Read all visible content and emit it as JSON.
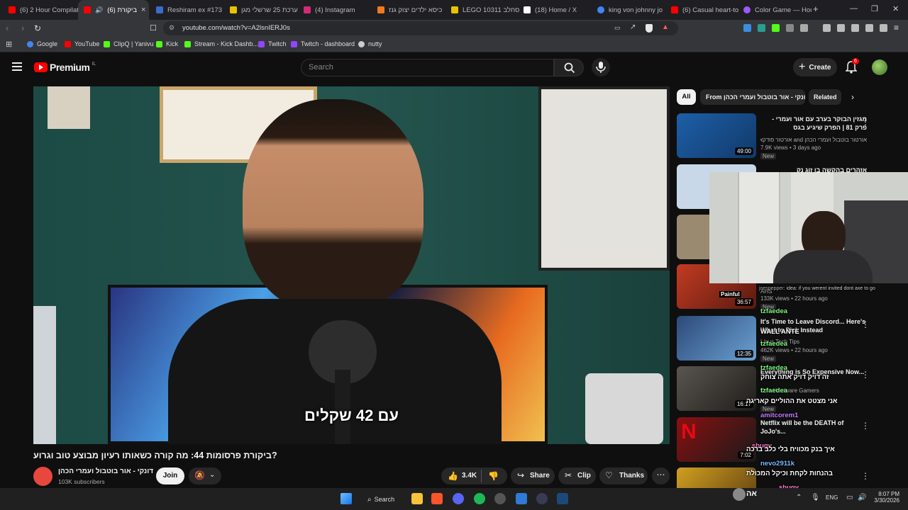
{
  "tabs": [
    {
      "title": "(6) 2 Hour Compilat",
      "fav_color": "#ff0000"
    },
    {
      "title": "(6) ביקורת",
      "fav_color": "#ff0000",
      "active": true
    },
    {
      "title": "Reshiram ex #173 P",
      "fav_color": "#3b6cc8"
    },
    {
      "title": "ערכת 25 שרשלי מגן",
      "fav_color": "#e8c400"
    },
    {
      "title": "(4) Instagram",
      "fav_color": "#d62976"
    },
    {
      "title": "כיסא ילדים יצוק גנז",
      "fav_color": "#f07b1d"
    },
    {
      "title": "LEGO 10311 סחלב",
      "fav_color": "#e8c400"
    },
    {
      "title": "(18) Home / X",
      "fav_color": "#ffffff"
    },
    {
      "title": "king von johnny jo",
      "fav_color": "#4285f4"
    },
    {
      "title": "(6) Casual heart-to-",
      "fav_color": "#ff0000"
    },
    {
      "title": "Color Game — Hou",
      "fav_color": "#9b59ff"
    }
  ],
  "browser": {
    "url": "youtube.com/watch?v=A2lsnIERJ0s",
    "new_tab": "+",
    "close_tab": "×"
  },
  "bookmarks": [
    {
      "label": "Google",
      "color": "#4285f4"
    },
    {
      "label": "YouTube",
      "color": "#ff0000"
    },
    {
      "label": "ClipQ | Yanivu",
      "color": "#53fc18"
    },
    {
      "label": "Kick",
      "color": "#53fc18"
    },
    {
      "label": "Stream - Kick Dashb...",
      "color": "#53fc18"
    },
    {
      "label": "Twitch",
      "color": "#9146ff"
    },
    {
      "label": "Twitch - dashboard",
      "color": "#9146ff"
    },
    {
      "label": "nutty",
      "color": "#cccccc"
    }
  ],
  "youtube": {
    "logo": "Premium",
    "logo_sup": "IL",
    "search_placeholder": "Search",
    "create_label": "Create",
    "notif_count": "6",
    "chips": [
      "All",
      "From דונקי - אור בוטבול ועמרי הכהן",
      "Related"
    ],
    "video_subtitle": "עם 42 שקלים",
    "video_title": "ביקורת פרסומות 44: מה קורה כשאותו רעיון מבוצע טוב וגרוע?",
    "channel_name": "דונקי - אור בוטבול ועמרי הכהן",
    "subscribers": "103K subscribers",
    "join_label": "Join",
    "likes": "3.4K",
    "share_label": "Share",
    "clip_label": "Clip",
    "thanks_label": "Thanks"
  },
  "sidebar": [
    {
      "title": "מגזין הבוקר בערב עם אור ועמרי - פרק 81 | הפרק שיגיע בגס",
      "channel": "אורטור בוטבול ועמרי הכהן and אורטור פודקאסטים",
      "meta": "7.9K views • 3 days ago",
      "badge": "New",
      "dur": "49:00",
      "thumb": "#1d5fa8"
    },
    {
      "title": "אזהרים בהקשה בן זוג נק",
      "channel": "",
      "meta": "",
      "badge": "",
      "dur": "",
      "thumb": "#c8d8e8"
    },
    {
      "title": "",
      "channel": "",
      "meta": "",
      "badge": "",
      "dur": "",
      "thumb": "#9a8a70"
    },
    {
      "title": "Painful",
      "channel": "AHS",
      "meta": "133K views • 22 hours ago",
      "badge": "New",
      "dur": "36:57",
      "thumb": "#c23b22"
    },
    {
      "title": "It's Time to Leave Discord... Here's What to Pick Instead",
      "channel": "Linus Tech Tips",
      "meta": "462K views • 22 hours ago",
      "badge": "New",
      "dur": "12:35",
      "thumb": "#2c4a7a"
    },
    {
      "title": "Everything is So Expensive Now...",
      "channel": "Tom Hardware Gamers",
      "meta": "",
      "badge": "New",
      "dur": "16:17",
      "thumb": "#5a5550"
    },
    {
      "title": "Netflix will be the DEATH of JoJo's...",
      "channel": "",
      "meta": "",
      "badge": "",
      "dur": "7:02",
      "thumb": "#8a1010"
    },
    {
      "title": "",
      "channel": "",
      "meta": "",
      "badge": "",
      "dur": "",
      "thumb": "#d0a020"
    }
  ],
  "chat": [
    {
      "user": "joespepper",
      "text": "idea: if you werent invited dont axe to go"
    },
    {
      "user": "tzfaedea",
      "text": ""
    },
    {
      "user": "",
      "text": "WALL ANTE"
    },
    {
      "user": "tzfaedea",
      "text": ""
    },
    {
      "user": "tzfaedea",
      "text": "זה דויק דויק אתה צוחק"
    },
    {
      "user": "tzfaedea",
      "text": ""
    },
    {
      "user": "",
      "text": "אני מצטט את ההוליים קאריגה"
    },
    {
      "user": "amitcorem1",
      "text": "אבל שדי תהיה דוזלי"
    },
    {
      "user": "sbugv",
      "text": ""
    },
    {
      "user": "",
      "text": "איך בנק מכוויח בלי כלב ברכה"
    },
    {
      "user": "nevo2911k",
      "text": ""
    },
    {
      "user": "",
      "text": "בהנחות לקחת וכיקל המכולת"
    },
    {
      "user": "sbugv",
      "text": ""
    },
    {
      "user": "",
      "text": "אה"
    }
  ],
  "taskbar": {
    "search_label": "Search",
    "lang": "ENG",
    "time": "8:07 PM",
    "date": "3/30/2026"
  }
}
